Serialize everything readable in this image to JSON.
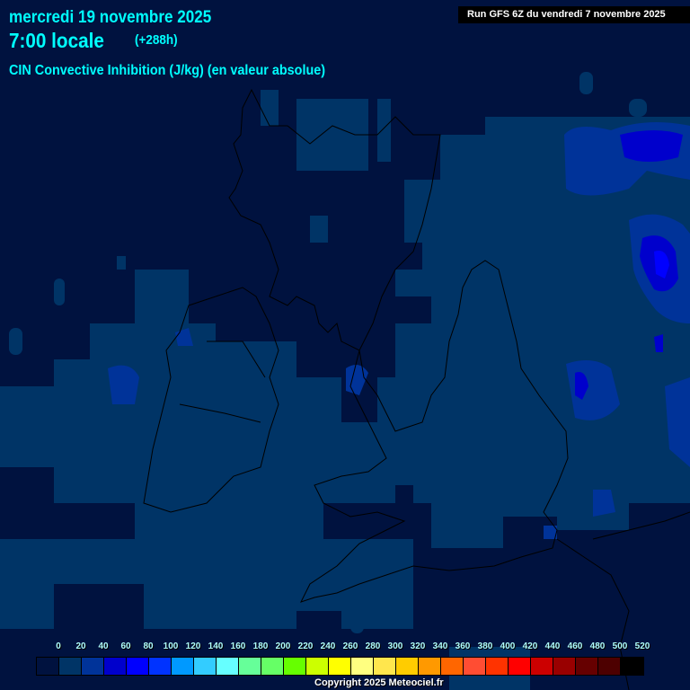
{
  "header": {
    "date": "mercredi 19 novembre 2025",
    "time": "7:00 locale",
    "lead": "(+288h)",
    "parameter": "CIN Convective Inhibition (J/kg) (en valeur absolue)",
    "run": "Run GFS 6Z du vendredi 7 novembre 2025"
  },
  "legend": {
    "labels": [
      "0",
      "20",
      "40",
      "60",
      "80",
      "100",
      "120",
      "140",
      "160",
      "180",
      "200",
      "220",
      "240",
      "260",
      "280",
      "300",
      "320",
      "340",
      "360",
      "380",
      "400",
      "420",
      "440",
      "460",
      "480",
      "500",
      "520"
    ],
    "colors": [
      "#00123f",
      "#003466",
      "#003399",
      "#0000cc",
      "#0000ff",
      "#0033ff",
      "#0099ff",
      "#33ccff",
      "#66ffff",
      "#66ff99",
      "#66ff66",
      "#66ff00",
      "#ccff00",
      "#ffff00",
      "#ffff80",
      "#ffe64d",
      "#ffcc00",
      "#ff9900",
      "#ff6600",
      "#ff4d33",
      "#ff3300",
      "#ff0000",
      "#cc0000",
      "#990000",
      "#660000",
      "#4d0000",
      "#000000"
    ]
  },
  "copyright": "Copyright 2025 Meteociel.fr"
}
